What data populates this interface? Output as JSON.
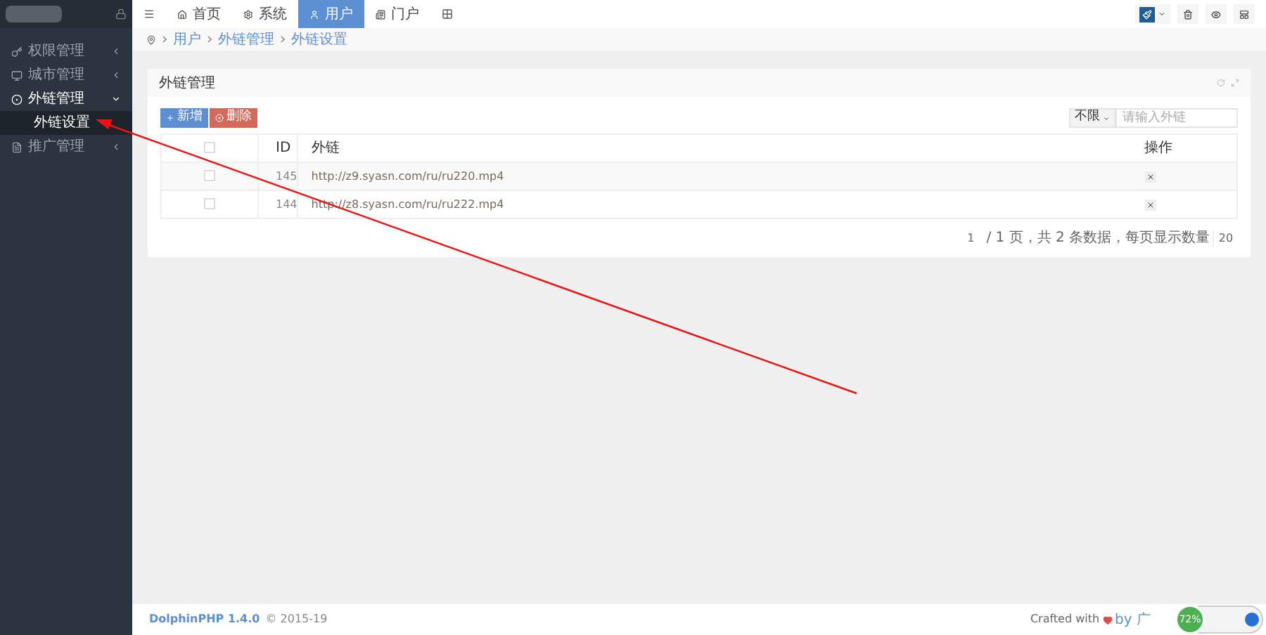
{
  "sidebar": {
    "items": [
      {
        "label": "权限管理",
        "kind": "group",
        "expanded": false
      },
      {
        "label": "城市管理",
        "kind": "group",
        "expanded": false
      },
      {
        "label": "外链管理",
        "kind": "group",
        "expanded": true,
        "children": [
          {
            "label": "外链设置",
            "selected": true
          }
        ]
      },
      {
        "label": "推广管理",
        "kind": "group",
        "expanded": false
      }
    ]
  },
  "topnav": {
    "tabs": [
      {
        "label": "首页",
        "selected": false
      },
      {
        "label": "系统",
        "selected": false
      },
      {
        "label": "用户",
        "selected": true
      },
      {
        "label": "门户",
        "selected": false
      }
    ]
  },
  "breadcrumb": [
    "用户",
    "外链管理",
    "外链设置"
  ],
  "card": {
    "title": "外链管理",
    "buttons": [
      {
        "label": "新增",
        "kind": "primary"
      },
      {
        "label": "删除",
        "kind": "danger"
      }
    ],
    "filter": {
      "select": "不限",
      "placeholder": "请输入外链"
    },
    "table": {
      "select_all_checked": false,
      "columns": [
        "ID",
        "外链",
        "操作"
      ],
      "rows": [
        {
          "id": "145",
          "url": "http://z9.syasn.com/ru/ru220.mp4",
          "checked": false
        },
        {
          "id": "144",
          "url": "http://z8.syasn.com/ru/ru222.mp4",
          "checked": false
        }
      ]
    },
    "pagination": {
      "page": "1",
      "summary": "/ 1 页，共 2 条数据，每页显示数量",
      "per_page": "20"
    }
  },
  "footer": {
    "brand": "DolphinPHP 1.4.0",
    "copyright": "© 2015-19",
    "credit_prefix": "Crafted with",
    "credit_by": "by 广"
  },
  "speed_widget": {
    "percent": "72%"
  }
}
